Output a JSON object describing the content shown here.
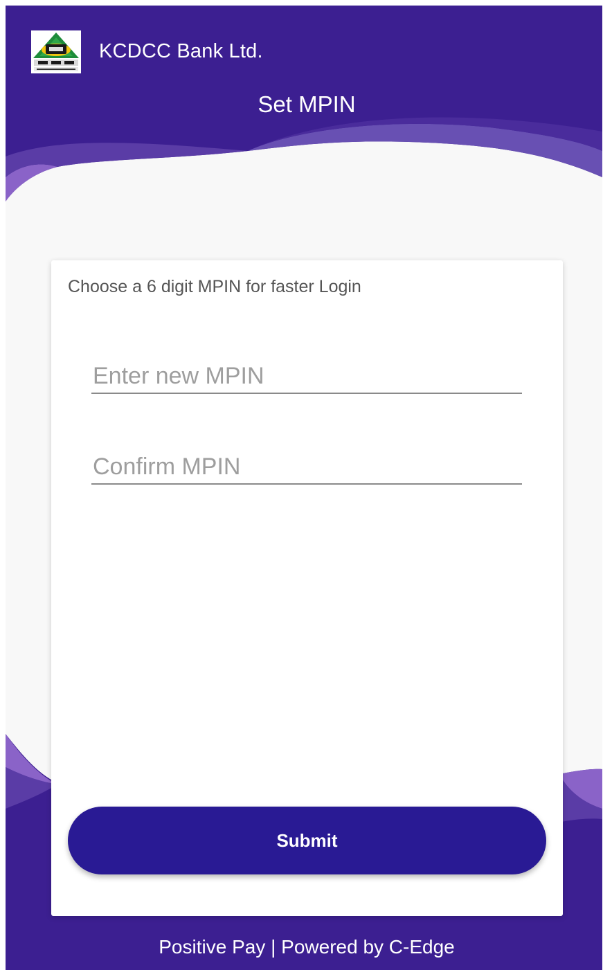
{
  "header": {
    "bank_name": "KCDCC Bank Ltd.",
    "title": "Set MPIN",
    "logo": {
      "icon": "dcc-bank-logo",
      "lettering": "DCC BANK Ltd."
    }
  },
  "form": {
    "instruction": "Choose a 6 digit MPIN for faster Login",
    "new_mpin": {
      "value": "",
      "placeholder": "Enter new MPIN"
    },
    "confirm_mpin": {
      "value": "",
      "placeholder": "Confirm MPIN"
    },
    "submit_label": "Submit"
  },
  "footer": {
    "text": "Positive Pay | Powered by C-Edge"
  },
  "colors": {
    "primary": "#3b1f91",
    "button": "#291a94",
    "wave_light": "#8a63c8",
    "card_bg": "#ffffff",
    "page_bg": "#f8f8f8"
  }
}
